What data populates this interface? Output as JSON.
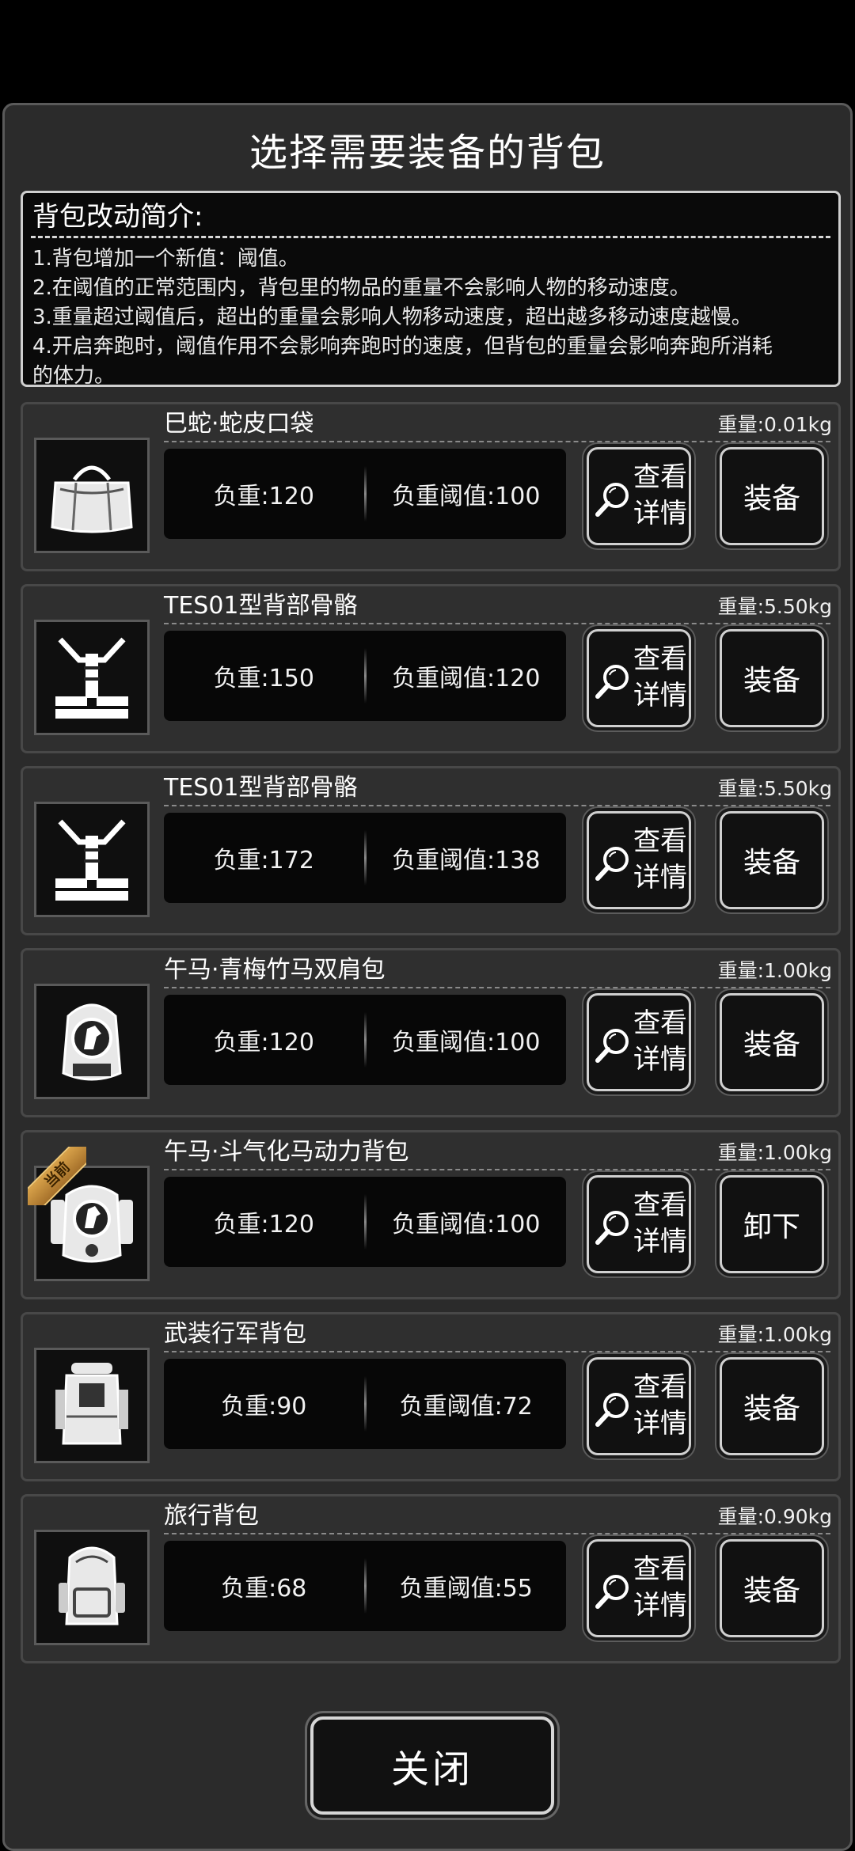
{
  "title": "选择需要装备的背包",
  "intro": {
    "heading": "背包改动简介:",
    "lines": [
      "1.背包增加一个新值：阈值。",
      "2.在阈值的正常范围内，背包里的物品的重量不会影响人物的移动速度。",
      "3.重量超过阈值后，超出的重量会影响人物移动速度，超出越多移动速度越慢。",
      "4.开启奔跑时，阈值作用不会影响奔跑时的速度，但背包的重量会影响奔跑所消耗",
      "的体力。"
    ]
  },
  "detail_label_1": "查看",
  "detail_label_2": "详情",
  "current_badge": "当前",
  "items": [
    {
      "name": "巳蛇·蛇皮口袋",
      "weight": "重量:0.01kg",
      "load": "负重:120",
      "threshold": "负重阈值:100",
      "action": "装备",
      "icon": "duffel-bag-icon"
    },
    {
      "name": "TES01型背部骨骼",
      "weight": "重量:5.50kg",
      "load": "负重:150",
      "threshold": "负重阈值:120",
      "action": "装备",
      "icon": "back-frame-icon"
    },
    {
      "name": "TES01型背部骨骼",
      "weight": "重量:5.50kg",
      "load": "负重:172",
      "threshold": "负重阈值:138",
      "action": "装备",
      "icon": "back-frame-icon"
    },
    {
      "name": "午马·青梅竹马双肩包",
      "weight": "重量:1.00kg",
      "load": "负重:120",
      "threshold": "负重阈值:100",
      "action": "装备",
      "icon": "horse-backpack-icon"
    },
    {
      "name": "午马·斗气化马动力背包",
      "weight": "重量:1.00kg",
      "load": "负重:120",
      "threshold": "负重阈值:100",
      "action": "卸下",
      "icon": "power-backpack-icon",
      "current": true
    },
    {
      "name": "武装行军背包",
      "weight": "重量:1.00kg",
      "load": "负重:90",
      "threshold": "负重阈值:72",
      "action": "装备",
      "icon": "military-backpack-icon"
    },
    {
      "name": "旅行背包",
      "weight": "重量:0.90kg",
      "load": "负重:68",
      "threshold": "负重阈值:55",
      "action": "装备",
      "icon": "travel-backpack-icon"
    }
  ],
  "close_label": "关闭"
}
